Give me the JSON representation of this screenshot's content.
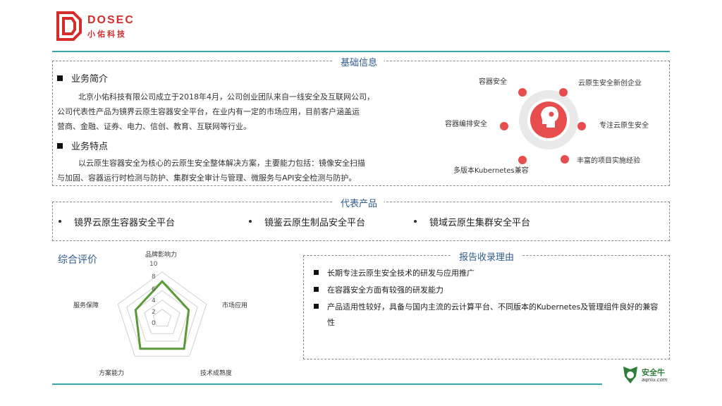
{
  "logo": {
    "name_en": "DOSEC",
    "name_cn": "小佑科技"
  },
  "basic": {
    "title": "基础信息",
    "intro_heading": "业务简介",
    "intro_lines": [
      "北京小佑科技有限公司成立于2018年4月，公司创业团队来自一线安全及互联网公司，",
      "公司代表性产品为镜界云原生容器安全平台，在业内有一定的市场应用，目前客户涵盖运",
      "营商、金融、证券、电力、信创、教育、互联网等行业。"
    ],
    "feature_heading": "业务特点",
    "feature_lines": [
      "以云原生容器安全为核心的云原生安全整体解决方案，主要能力包括：镜像安全扫描",
      "与加固、容器运行时检测与防护、集群安全审计与管理、微服务与API安全检测与防护。"
    ],
    "highlights": [
      "容器安全",
      "云原生安全新创企业",
      "容器编排安全",
      "专注云原生安全",
      "多版本Kubernetes兼容",
      "丰富的项目实施经验"
    ]
  },
  "products": {
    "title": "代表产品",
    "items": [
      "镜界云原生容器安全平台",
      "镜鉴云原生制品安全平台",
      "镜域云原生集群安全平台"
    ]
  },
  "evaluation": {
    "title": "综合评价",
    "ticks": [
      "10",
      "8",
      "6",
      "4",
      "2",
      "0"
    ]
  },
  "chart_data": {
    "type": "radar",
    "categories": [
      "品牌影响力",
      "市场应用",
      "技术成熟度",
      "方案能力",
      "服务保障"
    ],
    "values": [
      8,
      6,
      8,
      8,
      6
    ],
    "range": [
      0,
      10
    ],
    "color": "#5a9a3a"
  },
  "reasons": {
    "title": "报告收录理由",
    "items": [
      "长期专注云原生安全技术的研发与应用推广",
      "在容器安全方面有较强的研发能力",
      "产品适用性较好，具备与国内主流的云计算平台、不同版本的Kubernetes及管理组件良好的兼容性"
    ]
  },
  "brand": {
    "name": "安全牛",
    "site": "aqniu.com"
  },
  "colors": {
    "accent": "#3aa6a6",
    "brand_red": "#d62c2c",
    "title_blue": "#2d5d8e",
    "icon_red": "#e84d4d"
  }
}
